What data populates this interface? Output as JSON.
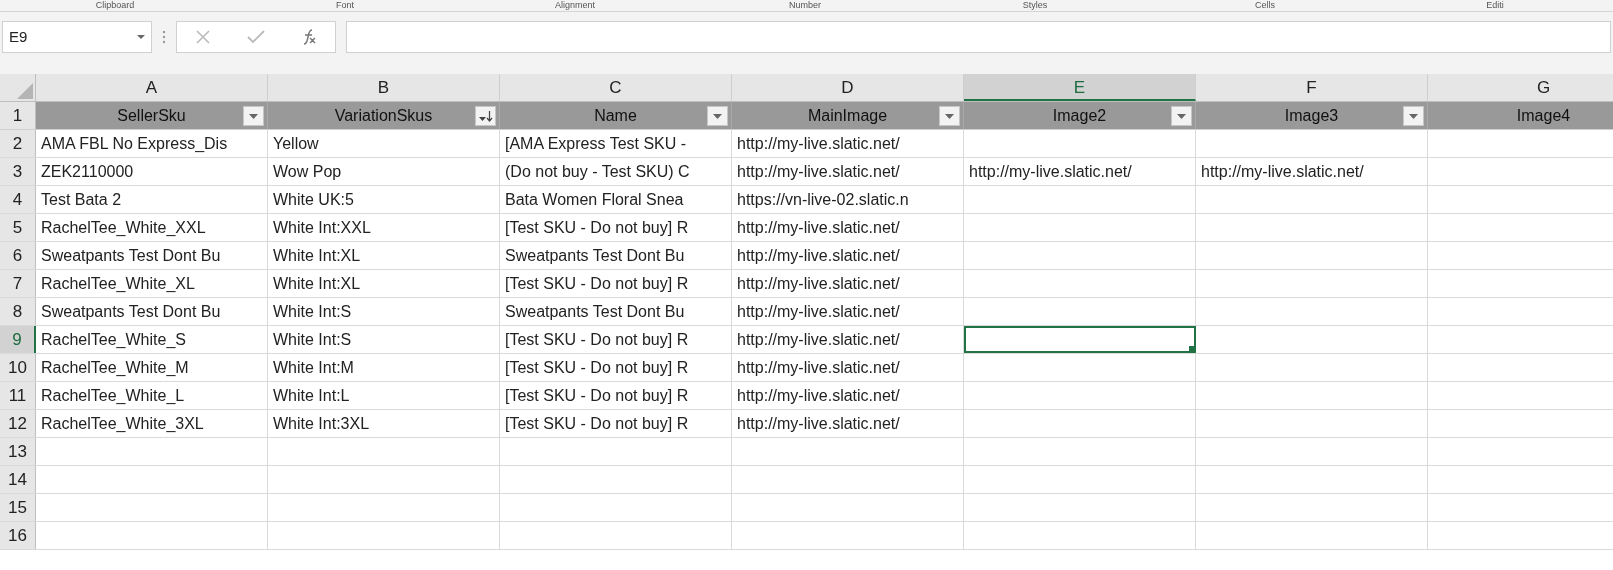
{
  "ribbon_groups": [
    "Clipboard",
    "Font",
    "Alignment",
    "Number",
    "Styles",
    "Cells",
    "Editi"
  ],
  "name_box": {
    "value": "E9"
  },
  "columns": [
    {
      "letter": "A",
      "header": "SellerSku",
      "filter_button": true,
      "sorted": false,
      "selected": false
    },
    {
      "letter": "B",
      "header": "VariationSkus",
      "filter_button": true,
      "sorted": true,
      "selected": false
    },
    {
      "letter": "C",
      "header": "Name",
      "filter_button": true,
      "sorted": false,
      "selected": false
    },
    {
      "letter": "D",
      "header": "MainImage",
      "filter_button": true,
      "sorted": false,
      "selected": false
    },
    {
      "letter": "E",
      "header": "Image2",
      "filter_button": true,
      "sorted": false,
      "selected": true
    },
    {
      "letter": "F",
      "header": "Image3",
      "filter_button": true,
      "sorted": false,
      "selected": false
    },
    {
      "letter": "G",
      "header": "Image4",
      "filter_button": false,
      "sorted": false,
      "selected": false
    }
  ],
  "header_row": {
    "number": "1",
    "selected": false
  },
  "rows": [
    {
      "number": "2",
      "selected": false,
      "cells": [
        "AMA FBL No Express_Dis",
        "Yellow",
        "[AMA Express Test SKU -",
        "http://my-live.slatic.net/",
        "",
        "",
        ""
      ]
    },
    {
      "number": "3",
      "selected": false,
      "cells": [
        "ZEK2110000",
        "Wow Pop",
        "(Do not buy - Test SKU) C",
        "http://my-live.slatic.net/",
        "http://my-live.slatic.net/",
        "http://my-live.slatic.net/",
        ""
      ]
    },
    {
      "number": "4",
      "selected": false,
      "cells": [
        "Test Bata 2",
        "White UK:5",
        "Bata Women Floral Snea",
        "https://vn-live-02.slatic.n",
        "",
        "",
        ""
      ]
    },
    {
      "number": "5",
      "selected": false,
      "cells": [
        "RachelTee_White_XXL",
        "White Int:XXL",
        "[Test SKU - Do not buy] R",
        "http://my-live.slatic.net/",
        "",
        "",
        ""
      ]
    },
    {
      "number": "6",
      "selected": false,
      "cells": [
        "Sweatpants Test Dont Bu",
        "White Int:XL",
        "Sweatpants Test Dont Bu",
        "http://my-live.slatic.net/",
        "",
        "",
        ""
      ]
    },
    {
      "number": "7",
      "selected": false,
      "cells": [
        "RachelTee_White_XL",
        "White Int:XL",
        "[Test SKU - Do not buy] R",
        "http://my-live.slatic.net/",
        "",
        "",
        ""
      ]
    },
    {
      "number": "8",
      "selected": false,
      "cells": [
        "Sweatpants Test Dont Bu",
        "White Int:S",
        "Sweatpants Test Dont Bu",
        "http://my-live.slatic.net/",
        "",
        "",
        ""
      ]
    },
    {
      "number": "9",
      "selected": true,
      "cells": [
        "RachelTee_White_S",
        "White Int:S",
        "[Test SKU - Do not buy] R",
        "http://my-live.slatic.net/",
        "",
        "",
        ""
      ]
    },
    {
      "number": "10",
      "selected": false,
      "cells": [
        "RachelTee_White_M",
        "White Int:M",
        "[Test SKU - Do not buy] R",
        "http://my-live.slatic.net/",
        "",
        "",
        ""
      ]
    },
    {
      "number": "11",
      "selected": false,
      "cells": [
        "RachelTee_White_L",
        "White Int:L",
        "[Test SKU - Do not buy] R",
        "http://my-live.slatic.net/",
        "",
        "",
        ""
      ]
    },
    {
      "number": "12",
      "selected": false,
      "cells": [
        "RachelTee_White_3XL",
        "White Int:3XL",
        "[Test SKU - Do not buy] R",
        "http://my-live.slatic.net/",
        "",
        "",
        ""
      ]
    },
    {
      "number": "13",
      "selected": false,
      "cells": [
        "",
        "",
        "",
        "",
        "",
        "",
        ""
      ]
    },
    {
      "number": "14",
      "selected": false,
      "cells": [
        "",
        "",
        "",
        "",
        "",
        "",
        ""
      ]
    },
    {
      "number": "15",
      "selected": false,
      "cells": [
        "",
        "",
        "",
        "",
        "",
        "",
        ""
      ]
    },
    {
      "number": "16",
      "selected": false,
      "cells": [
        "",
        "",
        "",
        "",
        "",
        "",
        ""
      ]
    }
  ]
}
